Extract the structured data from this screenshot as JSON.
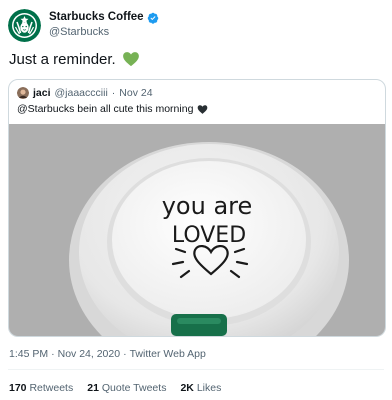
{
  "author": {
    "display_name": "Starbucks Coffee",
    "handle": "@Starbucks",
    "avatar_icon": "starbucks-siren-logo",
    "verified_icon": "verified-badge-icon",
    "brand_color": "#00704a"
  },
  "tweet": {
    "text": "Just a reminder.",
    "emoji": "green-heart"
  },
  "quoted_tweet": {
    "author_name": "jaci",
    "author_handle": "@jaaaccciii",
    "separator": "·",
    "date": "Nov 24",
    "text": "@Starbucks bein all cute this morning",
    "emoji": "black-heart",
    "image": {
      "lid_text_line1": "you are",
      "lid_text_line2": "LOVED"
    }
  },
  "meta": {
    "time": "1:45 PM",
    "sep1": "·",
    "date": "Nov 24, 2020",
    "sep2": "·",
    "source": "Twitter Web App"
  },
  "stats": {
    "retweets_count": "170",
    "retweets_label": "Retweets",
    "quote_count": "21",
    "quote_label": "Quote Tweets",
    "likes_count": "2K",
    "likes_label": "Likes"
  }
}
